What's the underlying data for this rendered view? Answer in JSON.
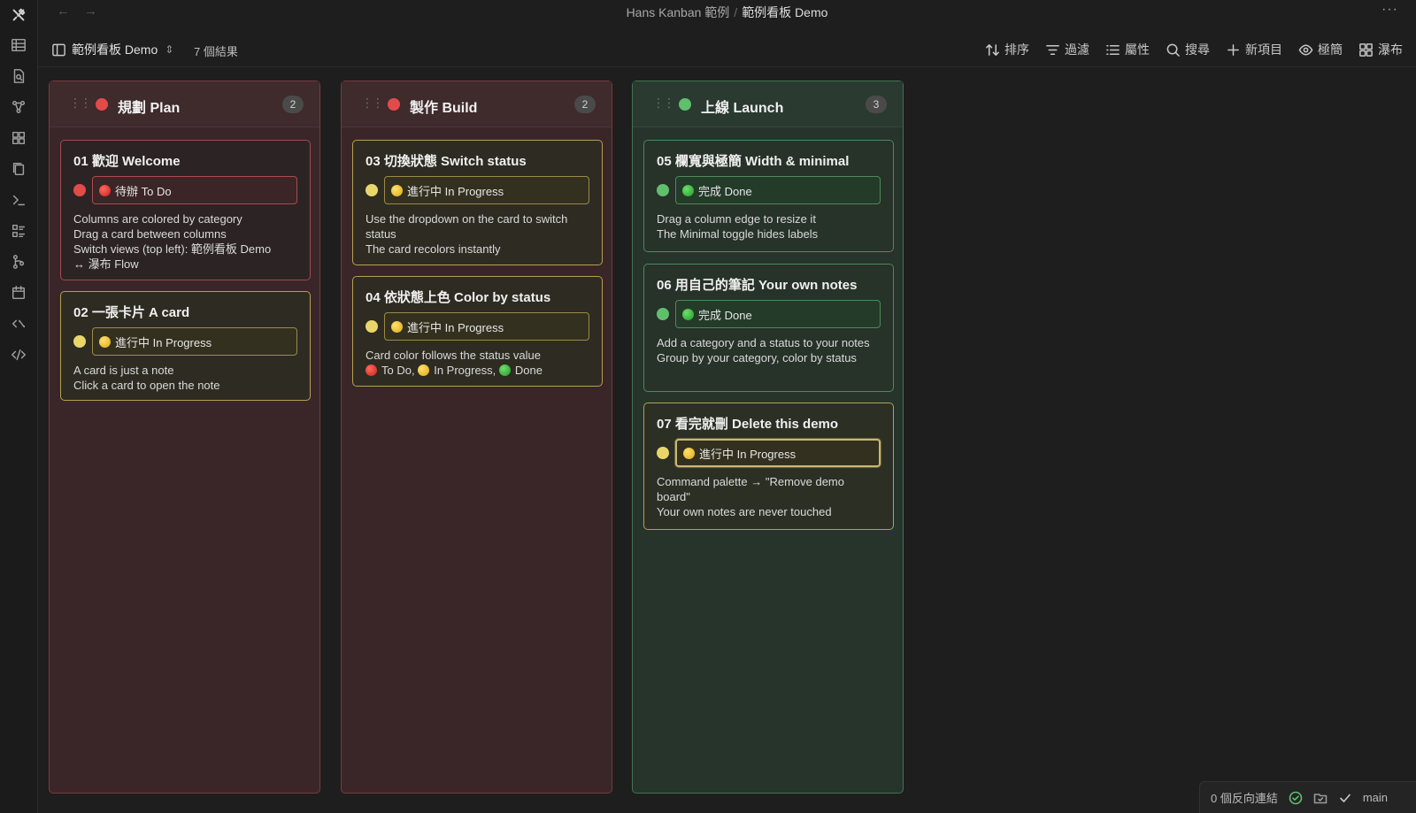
{
  "window": {
    "vault": "Hans Kanban 範例",
    "file": "範例看板 Demo",
    "more": "···"
  },
  "toolbar": {
    "view_name": "範例看板 Demo",
    "result_count": "7 個結果",
    "tools": [
      {
        "label": "排序",
        "icon": "sort-icon"
      },
      {
        "label": "過濾",
        "icon": "filter-icon"
      },
      {
        "label": "屬性",
        "icon": "properties-icon"
      },
      {
        "label": "搜尋",
        "icon": "search-icon"
      },
      {
        "label": "新項目",
        "icon": "plus-icon"
      },
      {
        "label": "極簡",
        "icon": "eye-icon"
      },
      {
        "label": "瀑布",
        "icon": "grid-icon"
      }
    ]
  },
  "colors": {
    "red": "#e24b4b",
    "yellow": "#e8d66a",
    "green": "#5fbf6c"
  },
  "columns": [
    {
      "title": "規劃 Plan",
      "count": "2",
      "color": "red",
      "cards": [
        {
          "title": "01 歡迎 Welcome",
          "status": "待辦 To Do",
          "lines": [
            "Columns are colored by category",
            "Drag a card between columns",
            "Switch views (top left): 範例看板 Demo",
            "↔ 瀑布 Flow"
          ]
        },
        {
          "title": "02 一張卡片 A card",
          "status": "進行中 In Progress",
          "lines": [
            "A card is just a note",
            "Click a card to open the note"
          ]
        }
      ]
    },
    {
      "title": "製作 Build",
      "count": "2",
      "color": "red",
      "cards": [
        {
          "title": "03 切換狀態 Switch status",
          "status": "進行中 In Progress",
          "lines": [
            "Use the dropdown on the card to switch status",
            "The card recolors instantly"
          ]
        },
        {
          "title": "04 依狀態上色 Color by status",
          "status": "進行中 In Progress",
          "lines": [
            "Card color follows the status value"
          ],
          "legend": [
            "To Do,",
            "In Progress,",
            "Done"
          ]
        }
      ]
    },
    {
      "title": "上線 Launch",
      "count": "3",
      "color": "green",
      "cards": [
        {
          "title": "05 欄寬與極簡 Width & minimal",
          "status": "完成 Done",
          "lines": [
            "Drag a column edge to resize it",
            "The Minimal toggle hides labels"
          ]
        },
        {
          "title": "06 用自己的筆記 Your own notes",
          "status": "完成 Done",
          "lines": [
            "Add a category and a status to your notes",
            "Group by your category, color by status"
          ]
        },
        {
          "title": "07 看完就刪 Delete this demo",
          "status": "進行中 In Progress",
          "lines": [
            "Command palette → \"Remove demo board\"",
            "Your own notes are never touched"
          ]
        }
      ]
    }
  ],
  "statusbar": {
    "backlinks": "0 個反向連結",
    "branch": "main"
  }
}
